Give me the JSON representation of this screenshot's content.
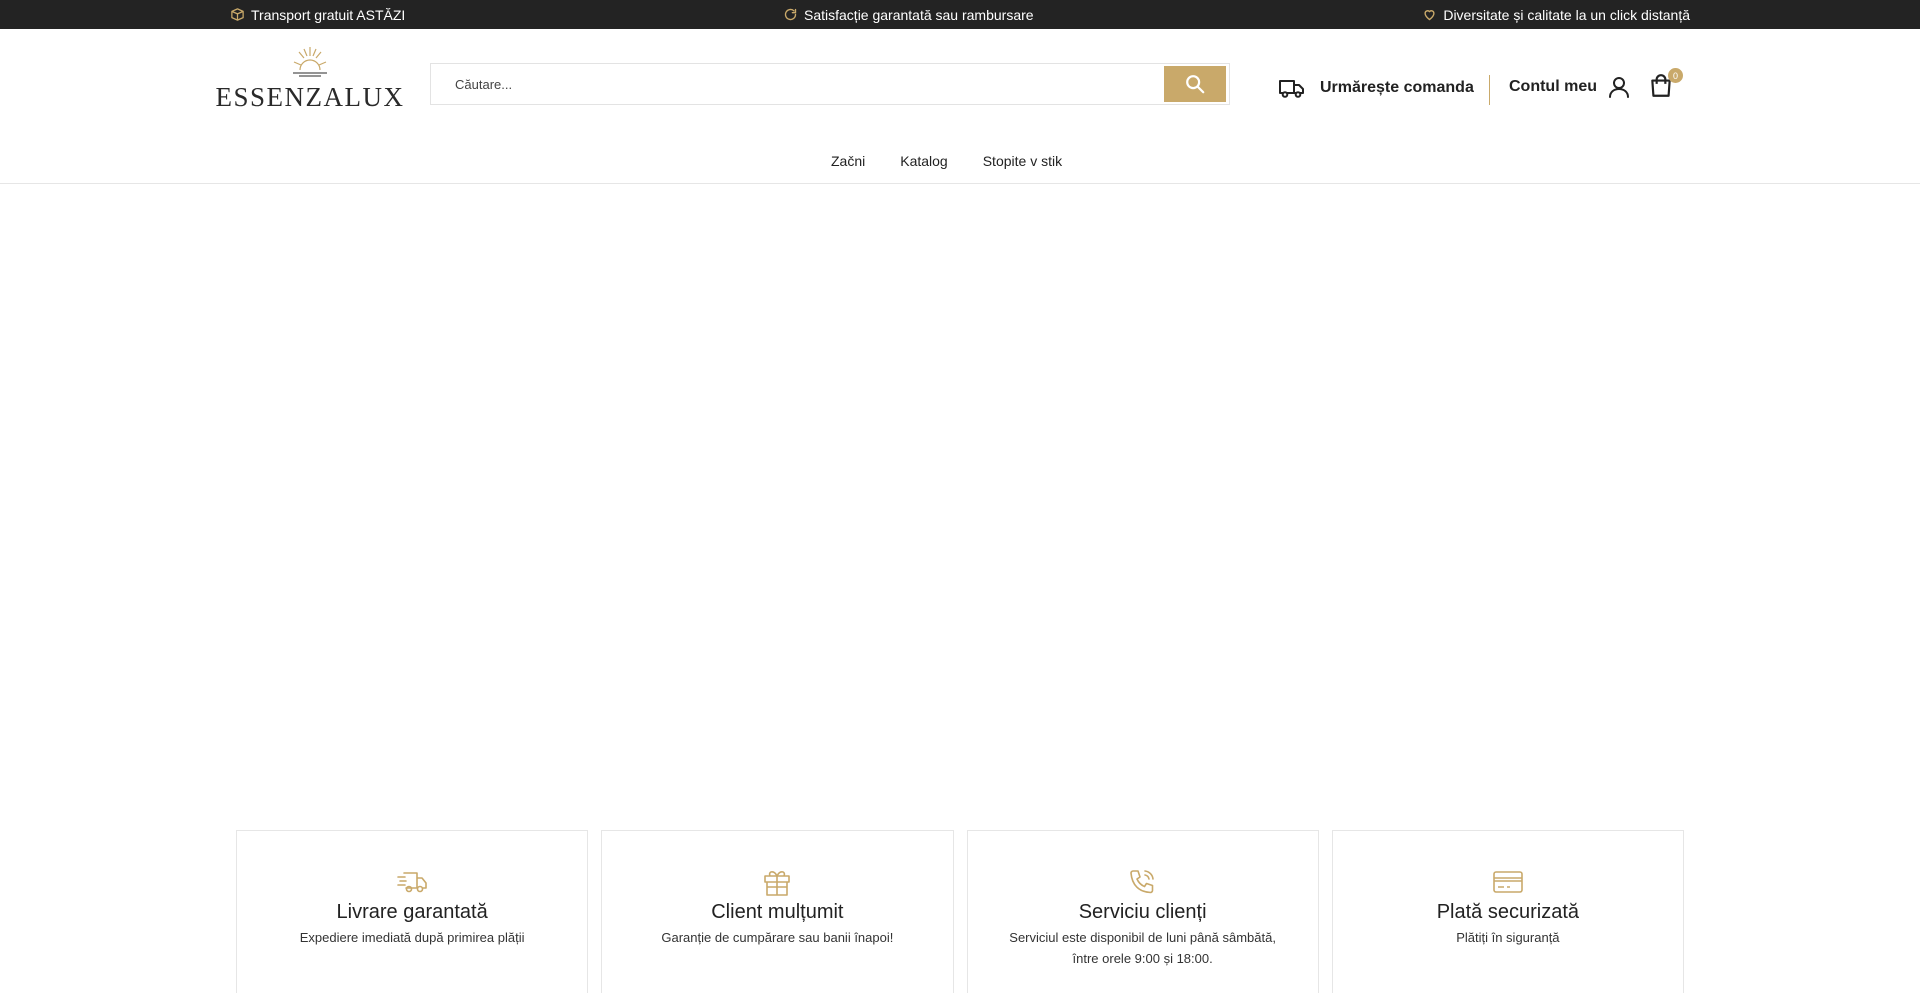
{
  "topbar": {
    "items": [
      {
        "icon": "box-icon",
        "text": "Transport gratuit ASTĂZI"
      },
      {
        "icon": "refresh-icon",
        "text": "Satisfacție garantată sau rambursare"
      },
      {
        "icon": "heart-icon",
        "text": "Diversitate și calitate la un click distanță"
      }
    ]
  },
  "header": {
    "logo_text": "ESSENZALUX",
    "search": {
      "placeholder": "Căutare..."
    },
    "track_order_label": "Urmărește comanda",
    "account_label": "Contul meu",
    "cart_count": "0"
  },
  "nav": {
    "items": [
      "Začni",
      "Katalog",
      "Stopite v stik"
    ]
  },
  "features": [
    {
      "icon": "fast-delivery-icon",
      "title": "Livrare garantată",
      "desc": "Expediere imediată după primirea plății"
    },
    {
      "icon": "gift-box-icon",
      "title": "Client mulțumit",
      "desc": "Garanție de cumpărare sau banii înapoi!"
    },
    {
      "icon": "phone-call-icon",
      "title": "Serviciu clienți",
      "desc": "Serviciul este disponibil de luni până sâmbătă, între orele 9:00 și 18:00."
    },
    {
      "icon": "credit-card-icon",
      "title": "Plată securizată",
      "desc": "Plătiți în siguranță"
    }
  ],
  "colors": {
    "accent": "#c9a96a",
    "topbar_bg": "#232323"
  }
}
